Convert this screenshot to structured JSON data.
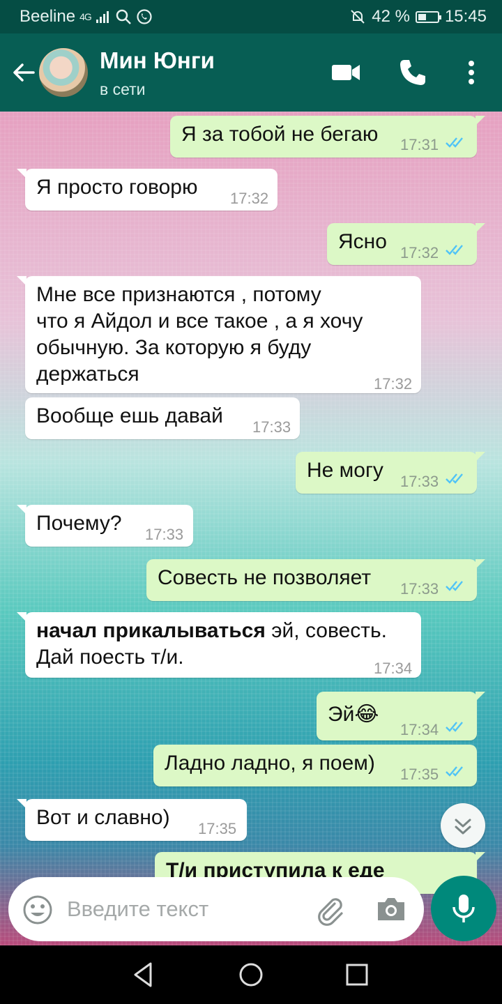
{
  "status_bar": {
    "carrier": "Beeline",
    "signal": "4G",
    "battery": "42 %",
    "battery_level": 0.42,
    "time": "15:45"
  },
  "header": {
    "contact_name": "Мин Юнги",
    "status": "в сети",
    "icons": [
      "back-arrow-icon",
      "video-call-icon",
      "phone-icon",
      "more-vert-icon"
    ]
  },
  "messages": [
    {
      "dir": "out",
      "text": "Я за тобой не бегаю",
      "time": "17:31"
    },
    {
      "dir": "in",
      "text": "Я просто говорю",
      "time": "17:32"
    },
    {
      "dir": "out",
      "text": "Ясно",
      "time": "17:32"
    },
    {
      "dir": "in",
      "lines": [
        "Мне все признаются , потому",
        "что я Айдол и все такое , а я хочу",
        "обычную. За которую я буду",
        "держаться"
      ],
      "time": "17:32"
    },
    {
      "dir": "in",
      "text": "Вообще ешь давай",
      "time": "17:33"
    },
    {
      "dir": "out",
      "text": "Не могу",
      "time": "17:33"
    },
    {
      "dir": "in",
      "text": "Почему?",
      "time": "17:33"
    },
    {
      "dir": "out",
      "text": "Совесть не позволяет",
      "time": "17:33"
    },
    {
      "dir": "in",
      "bold": "начал прикалываться",
      "line1_rest": " эй, совесть.",
      "line2": "Дай поесть т/и.",
      "time": "17:34"
    },
    {
      "dir": "out",
      "text": "Эй😂",
      "time": "17:34"
    },
    {
      "dir": "out",
      "text": "Ладно ладно, я поем)",
      "time": "17:35"
    },
    {
      "dir": "in",
      "text": "Вот и славно)",
      "time": "17:35"
    },
    {
      "dir": "out",
      "text": "Т/и приступила к еде",
      "time": ""
    }
  ],
  "input": {
    "placeholder": "Введите текст"
  },
  "colors": {
    "header": "#075e54",
    "status_bar": "#054d44",
    "outgoing_bubble": "#dcf8c6",
    "incoming_bubble": "#ffffff",
    "read_ticks": "#4fc3f7",
    "mic_button": "#00897b"
  }
}
